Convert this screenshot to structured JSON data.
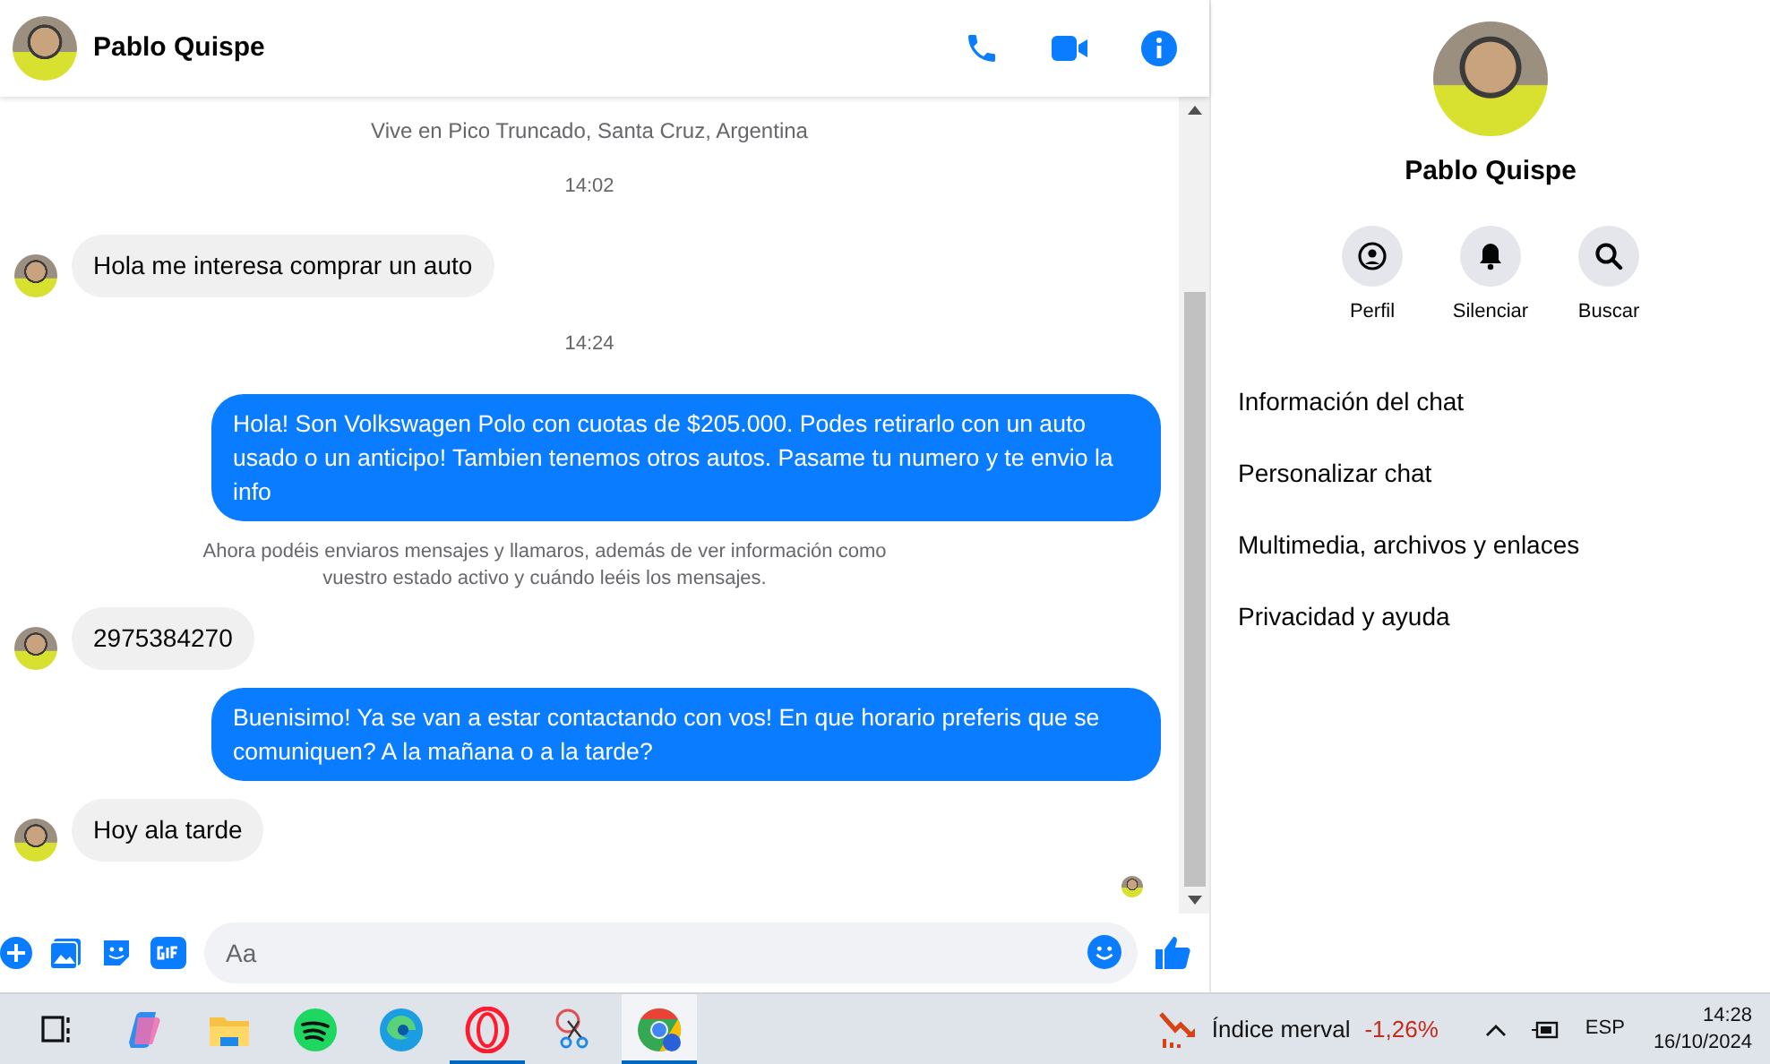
{
  "chat_header": {
    "name": "Pablo Quispe"
  },
  "messages": [
    {
      "kind": "info",
      "text": "Vive en Pico Truncado, Santa Cruz, Argentina"
    },
    {
      "kind": "time",
      "text": "14:02"
    },
    {
      "kind": "incoming",
      "text": "Hola me interesa comprar un auto"
    },
    {
      "kind": "time",
      "text": "14:24"
    },
    {
      "kind": "outgoing",
      "text": "Hola! Son Volkswagen Polo con cuotas de $205.000. Podes retirarlo con un auto usado o un anticipo! Tambien tenemos otros autos. Pasame tu numero y te envio la info"
    },
    {
      "kind": "notice",
      "text": "Ahora podéis enviaros mensajes y llamaros, además de ver información como vuestro estado activo y cuándo leéis los mensajes."
    },
    {
      "kind": "incoming",
      "text": "2975384270"
    },
    {
      "kind": "outgoing",
      "text": "Buenisimo! Ya se van a estar contactando con vos! En que horario preferis que se comuniquen? A la mañana o a la tarde?"
    },
    {
      "kind": "incoming",
      "text": "Hoy ala tarde"
    }
  ],
  "composer": {
    "placeholder": "Aa"
  },
  "profile_panel": {
    "name": "Pablo Quispe",
    "actions": [
      {
        "kind": "profile",
        "label": "Perfil"
      },
      {
        "kind": "mute",
        "label": "Silenciar"
      },
      {
        "kind": "search",
        "label": "Buscar"
      }
    ],
    "menu": [
      "Información del chat",
      "Personalizar chat",
      "Multimedia, archivos y enlaces",
      "Privacidad y ayuda"
    ]
  },
  "taskbar": {
    "apps": [
      {
        "kind": "taskview",
        "open": false,
        "selected": false
      },
      {
        "kind": "copilot",
        "open": false,
        "selected": false
      },
      {
        "kind": "explorer",
        "open": false,
        "selected": false
      },
      {
        "kind": "spotify",
        "open": false,
        "selected": false
      },
      {
        "kind": "edge",
        "open": false,
        "selected": false
      },
      {
        "kind": "opera",
        "open": true,
        "selected": false
      },
      {
        "kind": "snip",
        "open": false,
        "selected": false
      },
      {
        "kind": "chrome",
        "open": true,
        "selected": true
      }
    ],
    "widget": {
      "label": "Índice merval",
      "value": "-1,26%"
    },
    "language": "ESP",
    "time": "14:28",
    "date": "16/10/2024"
  }
}
